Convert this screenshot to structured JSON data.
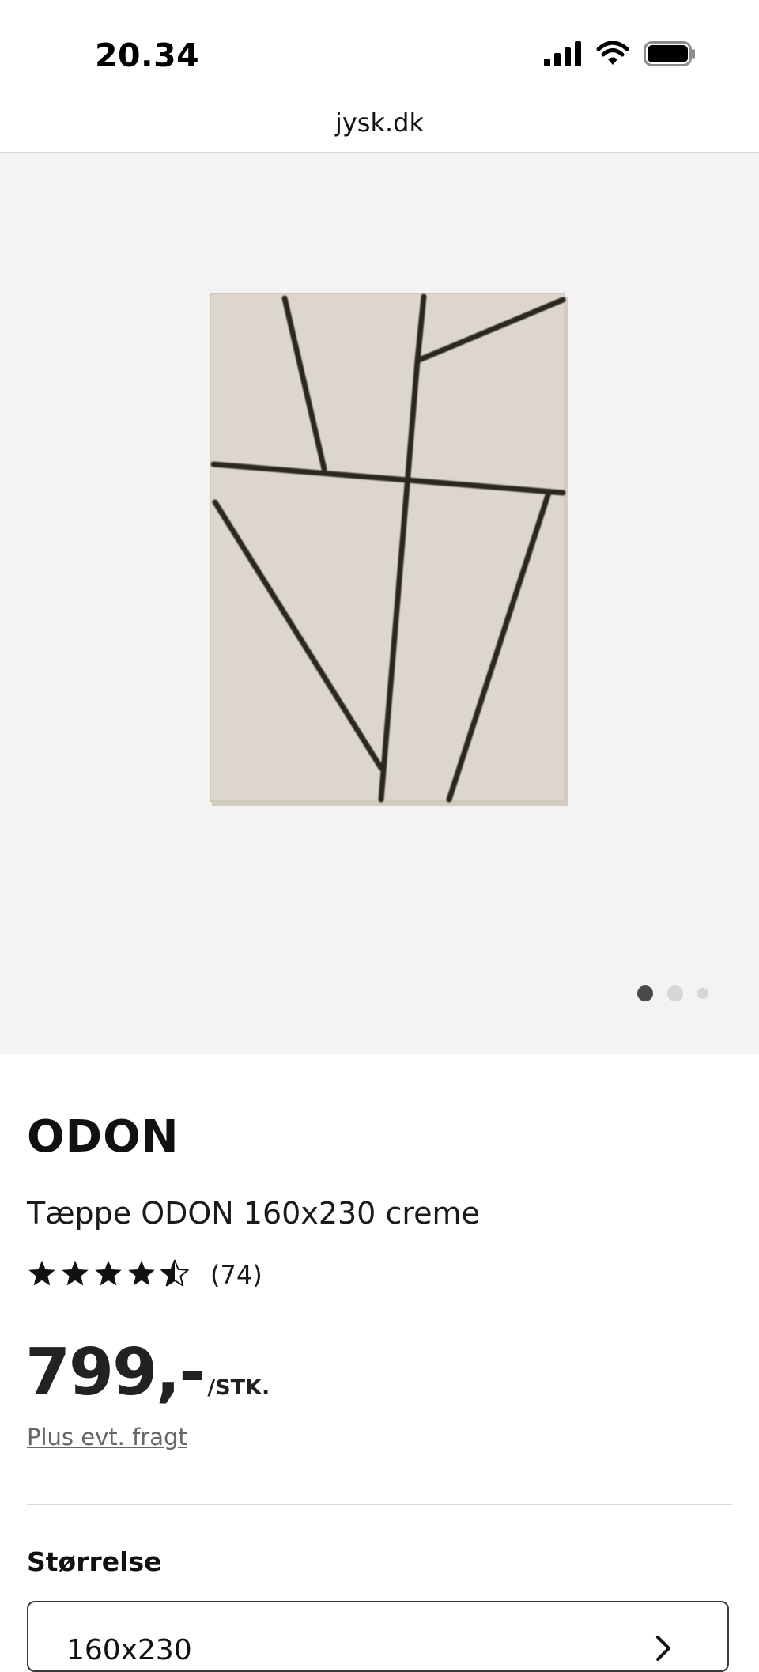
{
  "status_bar": {
    "time": "20.34",
    "icons": [
      "cellular-signal-icon",
      "wifi-icon",
      "battery-icon"
    ]
  },
  "browser": {
    "url": "jysk.dk"
  },
  "gallery": {
    "image": "rug-photo",
    "dots": {
      "count": 3,
      "active_index": 0
    }
  },
  "product": {
    "brand": "ODON",
    "name": "Tæppe ODON 160x230 creme",
    "rating": {
      "value": 4.5,
      "max": 5,
      "count_label": "(74)"
    },
    "price": "799,-",
    "unit": "/STK.",
    "shipping_link": "Plus evt. fragt"
  },
  "size_section": {
    "label": "Størrelse",
    "selected": "160x230"
  },
  "colors": {
    "gallery_bg": "#f3f3f3",
    "rug": "#dcd6cc",
    "rug_lines": "#2b2623",
    "star": "#111111"
  }
}
